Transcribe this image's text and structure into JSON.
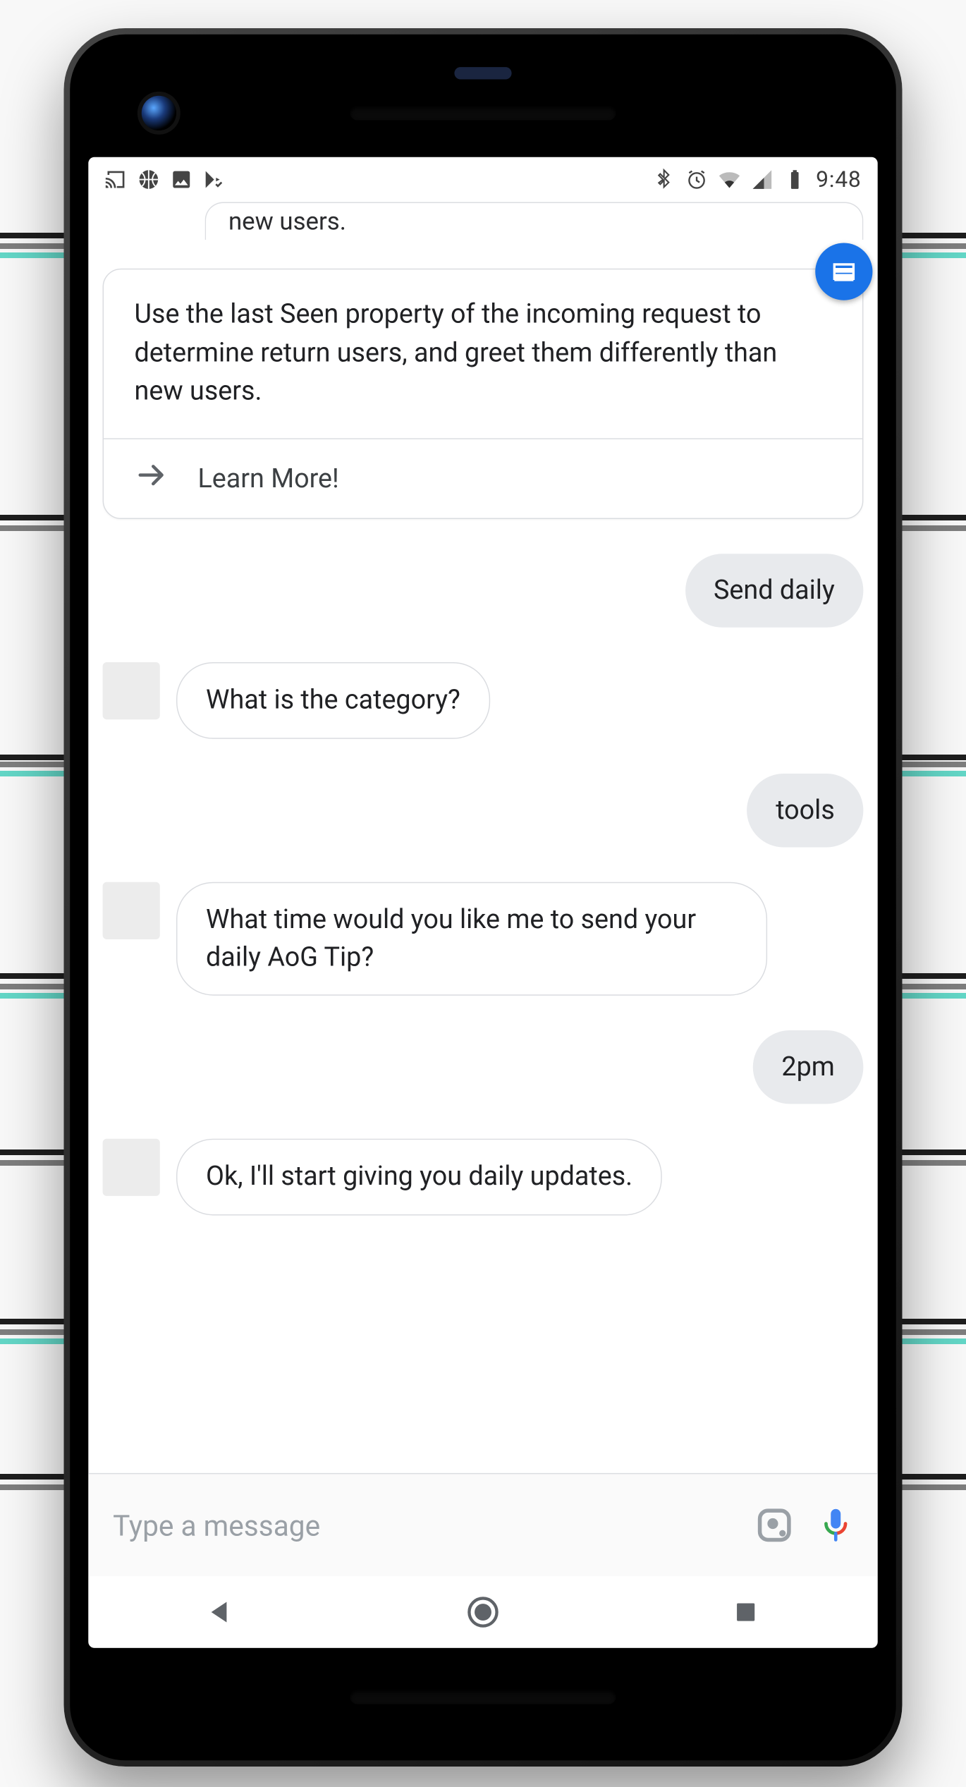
{
  "statusbar": {
    "time": "9:48",
    "icons_left": [
      "cast-icon",
      "basketball-icon",
      "image-icon",
      "playstore-check-icon"
    ],
    "icons_right": [
      "bluetooth-icon",
      "alarm-icon",
      "wifi-icon",
      "cell-icon",
      "battery-icon"
    ]
  },
  "chat": {
    "prev_card_tail": "new users.",
    "card": {
      "body": "Use the last Seen property of the incoming request to determine return users, and greet them differently than new users.",
      "action": "Learn More!",
      "fab_icon": "card-icon"
    },
    "messages": [
      {
        "side": "me",
        "text": "Send daily"
      },
      {
        "side": "bot",
        "text": "What is the category?"
      },
      {
        "side": "me",
        "text": "tools"
      },
      {
        "side": "bot",
        "text": "What time would you like me to send your daily AoG Tip?"
      },
      {
        "side": "me",
        "text": "2pm"
      },
      {
        "side": "bot",
        "text": "Ok, I'll start giving you daily updates."
      }
    ]
  },
  "composer": {
    "placeholder": "Type a message",
    "lens_icon": "lens-icon",
    "mic_icon": "mic-icon"
  },
  "nav": {
    "back": "back-button",
    "home": "home-button",
    "recent": "recent-button"
  },
  "colors": {
    "blue": "#1a73e8",
    "grey_bubble": "#e8eaed",
    "border": "#dadce0"
  }
}
